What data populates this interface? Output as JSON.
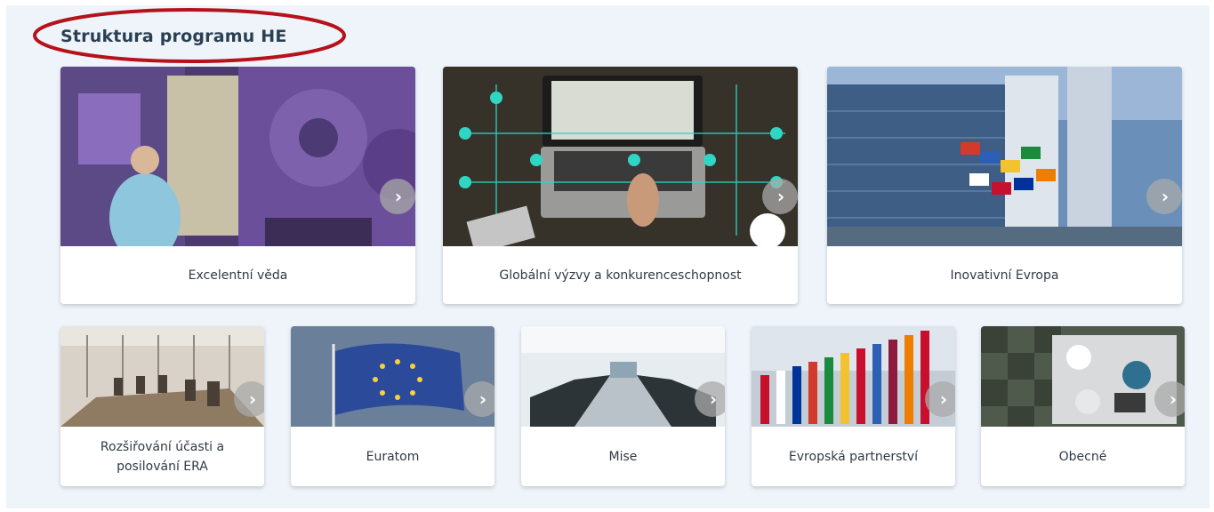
{
  "section": {
    "title": "Struktura programu HE"
  },
  "main_cards": [
    {
      "label": "Excelentní věda"
    },
    {
      "label": "Globální výzvy a konkurenceschopnost"
    },
    {
      "label": "Inovativní Evropa"
    }
  ],
  "secondary_cards": [
    {
      "label": "Rozšiřování účasti a posilování ERA"
    },
    {
      "label": "Euratom"
    },
    {
      "label": "Mise"
    },
    {
      "label": "Evropská partnerství"
    },
    {
      "label": "Obecné"
    }
  ],
  "icons": {
    "card_arrow": "chevron-right-icon"
  },
  "colors": {
    "panel_background": "#eef4fa",
    "title_highlight": "#b5121b",
    "title_text": "#2b3f52",
    "card_label_text": "#2f3a45"
  }
}
